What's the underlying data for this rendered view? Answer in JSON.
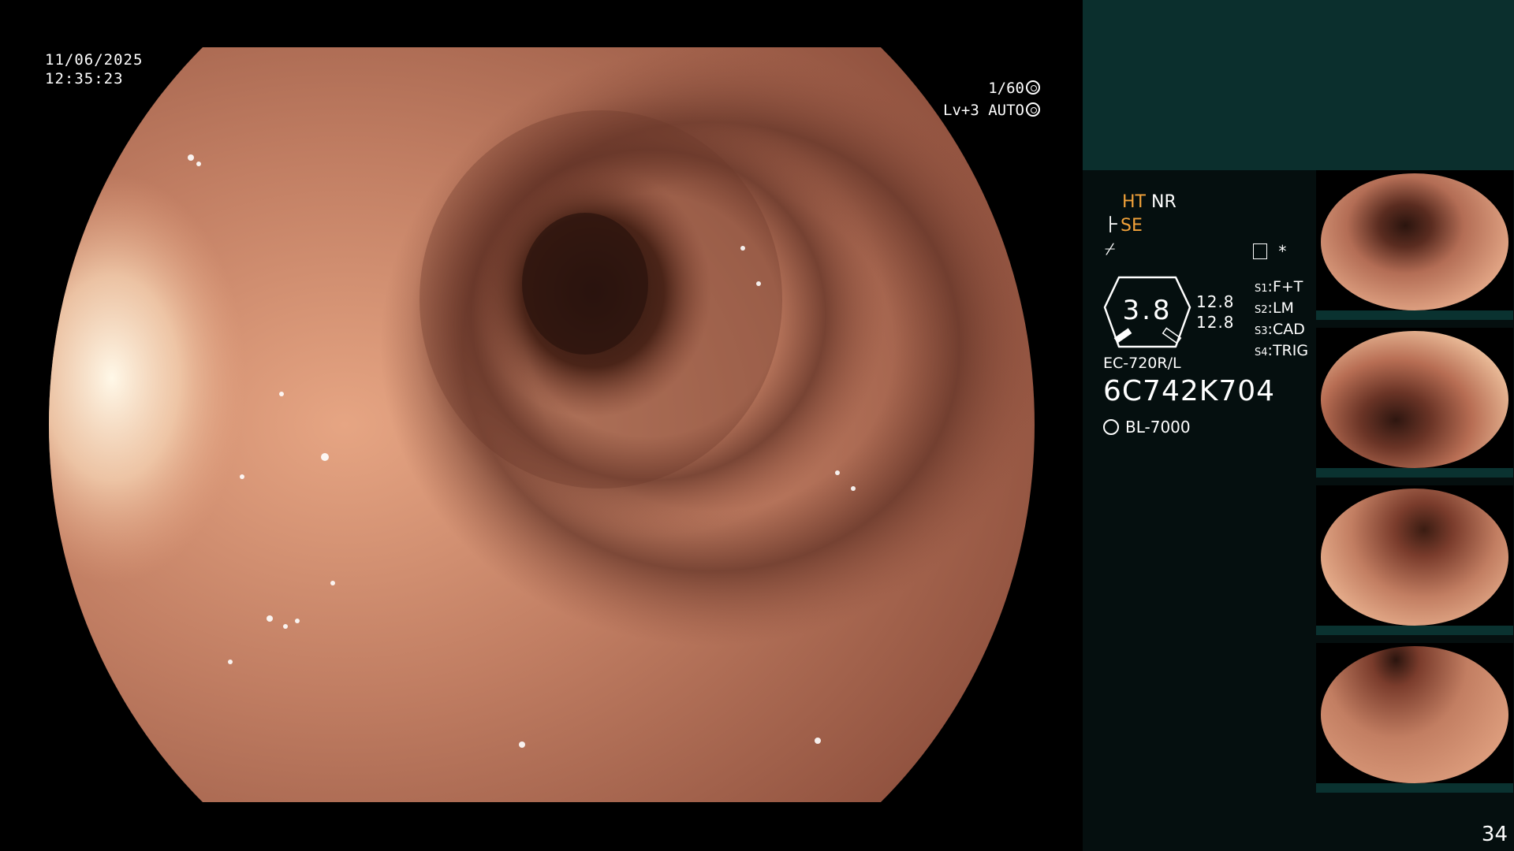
{
  "overlay": {
    "date": "11/06/2025",
    "time": "12:35:23",
    "shutter": "1/60",
    "level": "Lv+3",
    "iris_mode": "AUTO"
  },
  "side": {
    "mode_ht": "HT",
    "mode_nr": "NR",
    "mode_se": "SE",
    "dial_value": "3.8",
    "dial_num_top": "12.8",
    "dial_num_bottom": "12.8",
    "switches": [
      {
        "label": "S1",
        "value": "F+T"
      },
      {
        "label": "S2",
        "value": "LM"
      },
      {
        "label": "S3",
        "value": "CAD"
      },
      {
        "label": "S4",
        "value": "TRIG"
      }
    ],
    "scope_model": "EC-720R/L",
    "scope_serial": "6C742K704",
    "light_source": "BL-7000",
    "frame_count": "34"
  },
  "colors": {
    "accent": "#f2a23a",
    "panel_top": "#0b2f2d",
    "panel_bg": "#050f0f",
    "mucosa": "#b7735c"
  }
}
